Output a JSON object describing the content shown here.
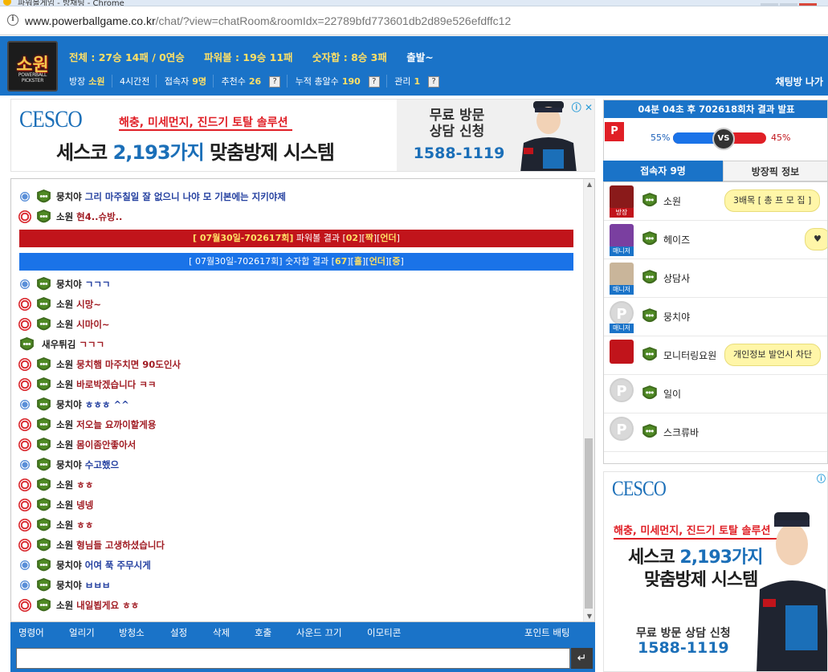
{
  "browser": {
    "title": "파워볼게임 - 방채팅 - Chrome",
    "url_host": "www.powerballgame.co.kr",
    "url_path": "/chat/?view=chatRoom&roomIdx=22789bfd773601db2d89e526efdffc12"
  },
  "header": {
    "logo_text": "소원",
    "logo_sub": "POWERBALL PICKSTER",
    "stat_total": "전체 : 27승 14패 / 0연승",
    "stat_powerball": "파워볼 : 19승 11패",
    "stat_sum": "숫자합 : 8승 3패",
    "stat_start": "출발~",
    "host_label": "방장",
    "host_value": "소원",
    "elapsed": "4시간전",
    "visitors_label": "접속자",
    "visitors_value": "9명",
    "recommend_label": "추천수",
    "recommend_value": "26",
    "hits_label": "누적 총알수",
    "hits_value": "190",
    "manage_label": "관리",
    "manage_value": "1",
    "q": "?",
    "leave_label": "채팅방 나가"
  },
  "ad_top": {
    "brand": "CESCO",
    "tag": "해충, 미세먼지, 진드기 토탈 솔루션",
    "main_pre": "세스코 ",
    "main_hl": "2,193가지",
    "main_post": " 맞춤방제 시스템",
    "cta1": "무료 방문",
    "cta2": "상담 신청",
    "phone": "1588-1119"
  },
  "chat": {
    "messages": [
      {
        "nick": "뭉치야",
        "text": "그리 마주칠일 잘 없으니 나야 모 기본에는 지키야제"
      },
      {
        "nick": "소원",
        "text": "현4..슈방.."
      },
      {
        "nick": "뭉치야",
        "text": "ㄱㄱㄱ"
      },
      {
        "nick": "소원",
        "text": "시망~"
      },
      {
        "nick": "소원",
        "text": "시마이~"
      },
      {
        "nick": "새우튀김",
        "text": "ㄱㄱㄱ"
      },
      {
        "nick": "소원",
        "text": "뭉치햄 마주치면 90도인사"
      },
      {
        "nick": "소원",
        "text": "바로박겠습니다 ㅋㅋ"
      },
      {
        "nick": "뭉치야",
        "text": "ㅎㅎㅎ ^^"
      },
      {
        "nick": "소원",
        "text": "저오늘 요까이할게용"
      },
      {
        "nick": "소원",
        "text": "몸이좀안좋아서"
      },
      {
        "nick": "뭉치야",
        "text": "수고했으"
      },
      {
        "nick": "소원",
        "text": "ㅎㅎ"
      },
      {
        "nick": "소원",
        "text": "넹넹"
      },
      {
        "nick": "소원",
        "text": "ㅎㅎ"
      },
      {
        "nick": "소원",
        "text": "형님들 고생하셨습니다"
      },
      {
        "nick": "뭉치야",
        "text": "어여 푹 주무시게"
      },
      {
        "nick": "뭉치야",
        "text": "ㅂㅂㅂ"
      },
      {
        "nick": "소원",
        "text": "내일뵙게요 ㅎㅎ"
      }
    ],
    "banner_red": {
      "round": "[ 07월30일-702617회]",
      "label": "파워볼 결과 [",
      "r1": "02",
      "r2": "짝",
      "r3": "언더",
      "sep1": "][",
      "sep2": "][",
      "end": "]"
    },
    "banner_blue": {
      "round": "[ 07월30일-702617회]",
      "label": "숫자합 결과 [",
      "r1": "67",
      "r2": "홀",
      "r3": "언더",
      "r4": "중",
      "sep1": "][",
      "sep2": "][",
      "sep3": "][",
      "end": "]"
    }
  },
  "menu": {
    "items": [
      "명령어",
      "얼리기",
      "방청소",
      "설정",
      "삭제",
      "호출",
      "사운드 끄기",
      "이모티콘"
    ],
    "point": "포인트 배팅",
    "send_icon": "↵"
  },
  "result": {
    "header": "04분 04초 후 702618회차 결과 발표",
    "p": "P",
    "left_pct": "55%",
    "right_pct": "45%",
    "left_share": 0.55,
    "vs": "VS"
  },
  "tabs": {
    "users": "접속자 9명",
    "info": "방장픽 정보"
  },
  "users": [
    {
      "name": "소원",
      "role": "방장",
      "bubble": "3배목 [ 총 프 모 집 ]"
    },
    {
      "name": "헤이즈",
      "role": "매니저",
      "bubble": "♥"
    },
    {
      "name": "상담사",
      "role": "매니저",
      "bubble": ""
    },
    {
      "name": "뭉치야",
      "role": "매니저",
      "bubble": ""
    },
    {
      "name": "모니터링요원",
      "role": "",
      "bubble": "개인정보 발언시 차단"
    },
    {
      "name": "일이",
      "role": "",
      "bubble": ""
    },
    {
      "name": "스크류바",
      "role": "",
      "bubble": ""
    }
  ],
  "ad_side": {
    "brand": "CESCO",
    "tag": "해충, 미세먼지, 진드기 토탈 솔루션",
    "main_pre": "세스코 ",
    "main_hl": "2,193가지",
    "main2": "맞춤방제 시스템",
    "cta1": "무료 방문 상담 신청",
    "phone": "1588-1119"
  },
  "colors": {
    "primary": "#1a73c8",
    "accent_red": "#c1141b",
    "accent_blue": "#1a73e8",
    "highlight": "#ffe066"
  }
}
